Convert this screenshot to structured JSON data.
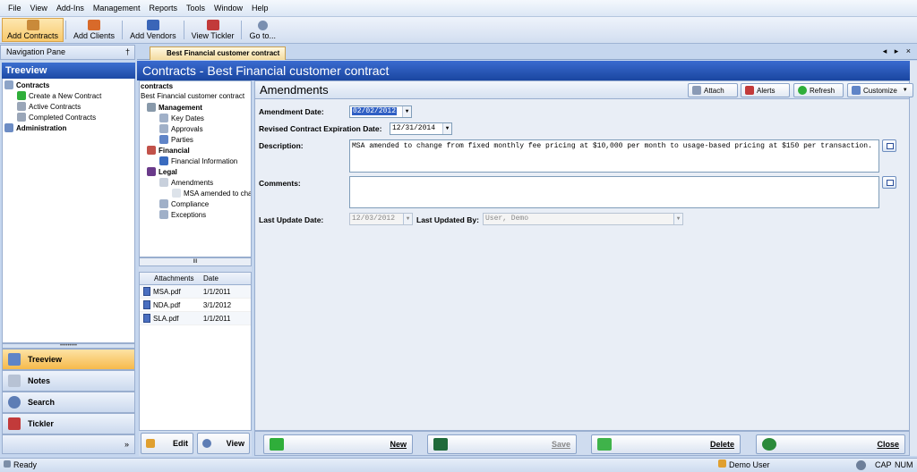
{
  "menu": [
    "File",
    "View",
    "Add-Ins",
    "Management",
    "Reports",
    "Tools",
    "Window",
    "Help"
  ],
  "toolbar": {
    "add_contracts": "Add Contracts",
    "add_clients": "Add Clients",
    "add_vendors": "Add Vendors",
    "view_tickler": "View Tickler",
    "goto": "Go to..."
  },
  "nav": {
    "header": "Navigation Pane",
    "pin": "†",
    "treeview_title": "Treeview",
    "tree": {
      "contracts": "Contracts",
      "create": "Create a New Contract",
      "active": "Active Contracts",
      "completed": "Completed Contracts",
      "administration": "Administration"
    },
    "buttons": {
      "treeview": "Treeview",
      "notes": "Notes",
      "search": "Search",
      "tickler": "Tickler"
    },
    "splitter": "•••••••••",
    "more": "»"
  },
  "tab": {
    "label": "Best Financial customer contract",
    "controls": "◂ ▸ ×"
  },
  "content_title": "Contracts - Best Financial customer contract",
  "mid_tree": {
    "root": "contracts",
    "contract": "Best Financial customer contract",
    "management": "Management",
    "key_dates": "Key Dates",
    "approvals": "Approvals",
    "parties": "Parties",
    "financial": "Financial",
    "financial_info": "Financial Information",
    "legal": "Legal",
    "amendments": "Amendments",
    "msa_amended": "MSA amended to cha",
    "compliance": "Compliance",
    "exceptions": "Exceptions",
    "hscroll": "III"
  },
  "attachments": {
    "headers": [
      "Attachments",
      "Date"
    ],
    "rows": [
      [
        "MSA.pdf",
        "1/1/2011"
      ],
      [
        "NDA.pdf",
        "3/1/2012"
      ],
      [
        "SLA.pdf",
        "1/1/2011"
      ]
    ]
  },
  "mid_buttons": {
    "edit": "Edit",
    "view": "View"
  },
  "form": {
    "title": "Amendments",
    "attach": "Attach",
    "alerts": "Alerts",
    "refresh": "Refresh",
    "customize": "Customize",
    "amendment_date_label": "Amendment Date:",
    "amendment_date": "02/02/2012",
    "revised_label": "Revised Contract Expiration Date:",
    "revised_date": "12/31/2014",
    "description_label": "Description:",
    "description": "MSA amended to change from fixed monthly fee pricing at $10,000 per month to usage-based pricing at $150 per transaction.",
    "comments_label": "Comments:",
    "comments": "",
    "last_update_label": "Last Update Date:",
    "last_update": "12/03/2012",
    "last_updated_by_label": "Last Updated By:",
    "last_updated_by": "User, Demo",
    "arrow": "▼"
  },
  "form_buttons": {
    "new": "New",
    "save": "Save",
    "delete": "Delete",
    "close": "Close"
  },
  "status": {
    "ready": "Ready",
    "user": "Demo User",
    "cap": "CAP",
    "num": "NUM"
  }
}
